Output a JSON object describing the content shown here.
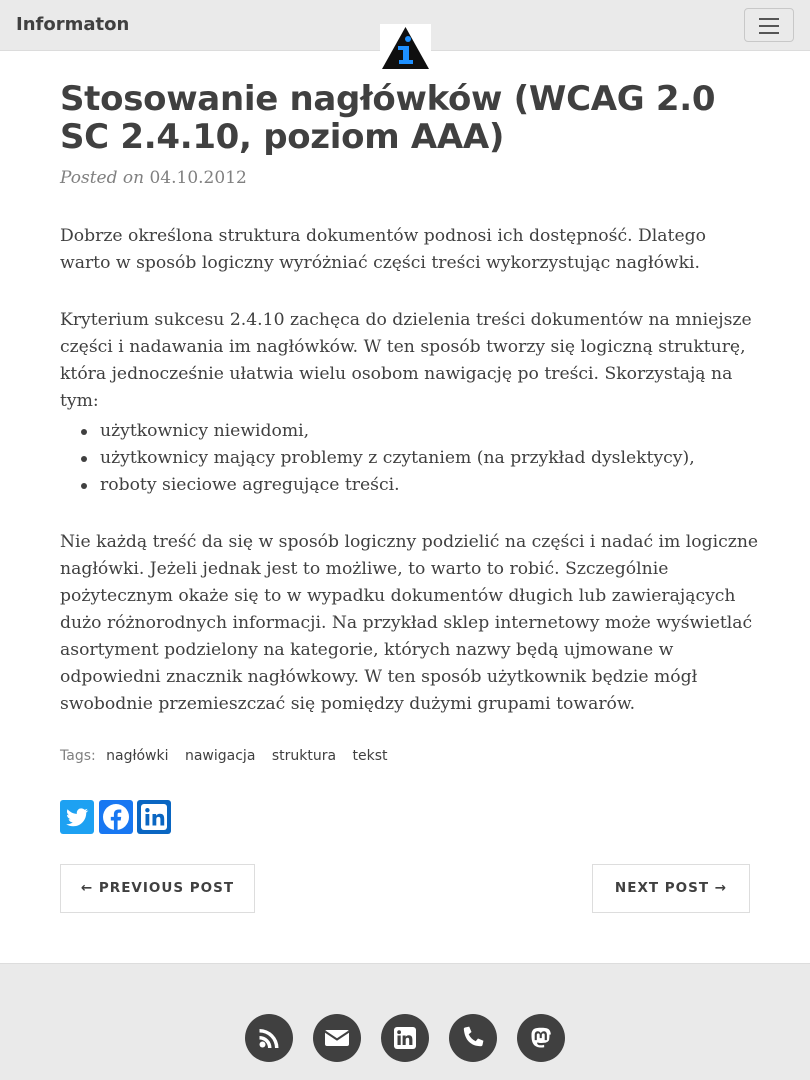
{
  "navbar": {
    "brand": "Informaton",
    "logo_icon": "info-triangle-logo",
    "menu_icon": "hamburger-icon"
  },
  "post": {
    "title": "Stosowanie nagłówków (WCAG 2.0 SC 2.4.10, poziom AAA)",
    "posted_on_label": "Posted on",
    "date": "04.10.2012",
    "paragraph1": "Dobrze określona struktura dokumentów podnosi ich dostępność. Dlatego warto w sposób logiczny wyróżniać części treści wykorzystując nagłówki.",
    "paragraph2": "Kryterium sukcesu 2.4.10 zachęca do dzielenia treści dokumentów na mniejsze części i nadawania im nagłówków. W ten sposób tworzy się logiczną strukturę, która jednocześnie ułatwia wielu osobom nawigację po treści. Skorzystają na tym:",
    "list": [
      "użytkownicy niewidomi,",
      "użytkownicy mający problemy z czytaniem (na przykład dyslektycy),",
      "roboty sieciowe agregujące treści."
    ],
    "paragraph3": "Nie każdą treść da się w sposób logiczny podzielić na części i nadać im logiczne nagłówki. Jeżeli jednak jest to możliwe, to warto to robić. Szczególnie pożytecznym okaże się to w wypadku dokumentów długich lub zawierających dużo różnorodnych informacji. Na przykład sklep internetowy może wyświetlać asortyment podzielony na kategorie, których nazwy będą ujmowane w odpowiedni znacznik nagłówkowy. W ten sposób użytkownik będzie mógł swobodnie przemieszczać się pomiędzy dużymi grupami towarów."
  },
  "tags": {
    "label": "Tags:",
    "items": [
      "nagłówki",
      "nawigacja",
      "struktura",
      "tekst"
    ]
  },
  "share": {
    "icons": [
      "twitter-icon",
      "facebook-icon",
      "linkedin-icon"
    ],
    "colors": {
      "twitter": "#1da1f2",
      "facebook": "#1877f2",
      "linkedin": "#0a66c2"
    }
  },
  "pager": {
    "previous": "← PREVIOUS POST",
    "next": "NEXT POST →"
  },
  "footer": {
    "icons": [
      "rss-icon",
      "envelope-icon",
      "linkedin-icon",
      "phone-icon",
      "mastodon-icon"
    ]
  },
  "colors": {
    "text": "#404040",
    "muted": "#808080",
    "navbar_bg": "#eaeaea",
    "logo_accent": "#1e90ff"
  }
}
